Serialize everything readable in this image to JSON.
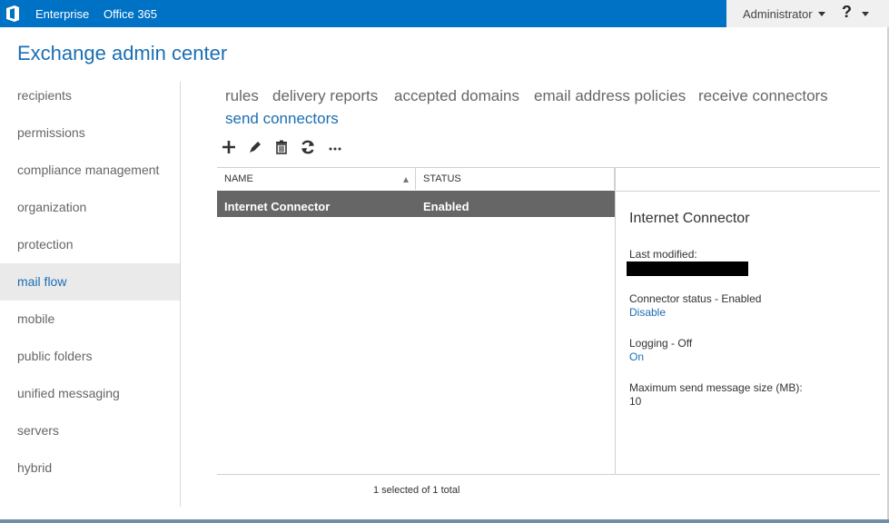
{
  "topbar": {
    "logo_icon": "office-logo-icon",
    "links": [
      "Enterprise",
      "Office 365"
    ],
    "user": "Administrator",
    "help": "?",
    "color": "#0072c6"
  },
  "app_title": "Exchange admin center",
  "nav": {
    "items": [
      "recipients",
      "permissions",
      "compliance management",
      "organization",
      "protection",
      "mail flow",
      "mobile",
      "public folders",
      "unified messaging",
      "servers",
      "hybrid"
    ],
    "active": "mail flow"
  },
  "tabs": {
    "items": [
      "rules",
      "delivery reports",
      "accepted domains",
      "email address policies",
      "receive connectors",
      "send connectors"
    ],
    "active": "send connectors"
  },
  "toolbar": {
    "icons": [
      "add-icon",
      "edit-icon",
      "delete-icon",
      "refresh-icon",
      "more-icon"
    ]
  },
  "list": {
    "columns": [
      "NAME",
      "STATUS"
    ],
    "rows": [
      {
        "name": "Internet Connector",
        "status": "Enabled"
      }
    ]
  },
  "details": {
    "title": "Internet Connector",
    "last_modified_label": "Last modified:",
    "connector_status_label": "Connector status - Enabled",
    "connector_status_action": "Disable",
    "logging_label": "Logging - Off",
    "logging_action": "On",
    "max_size_label": "Maximum send message size (MB):",
    "max_size_value": "10"
  },
  "footer": {
    "status": "1 selected of 1 total"
  },
  "colors": {
    "accent": "#1b6eb4",
    "selected_row": "#666666"
  }
}
